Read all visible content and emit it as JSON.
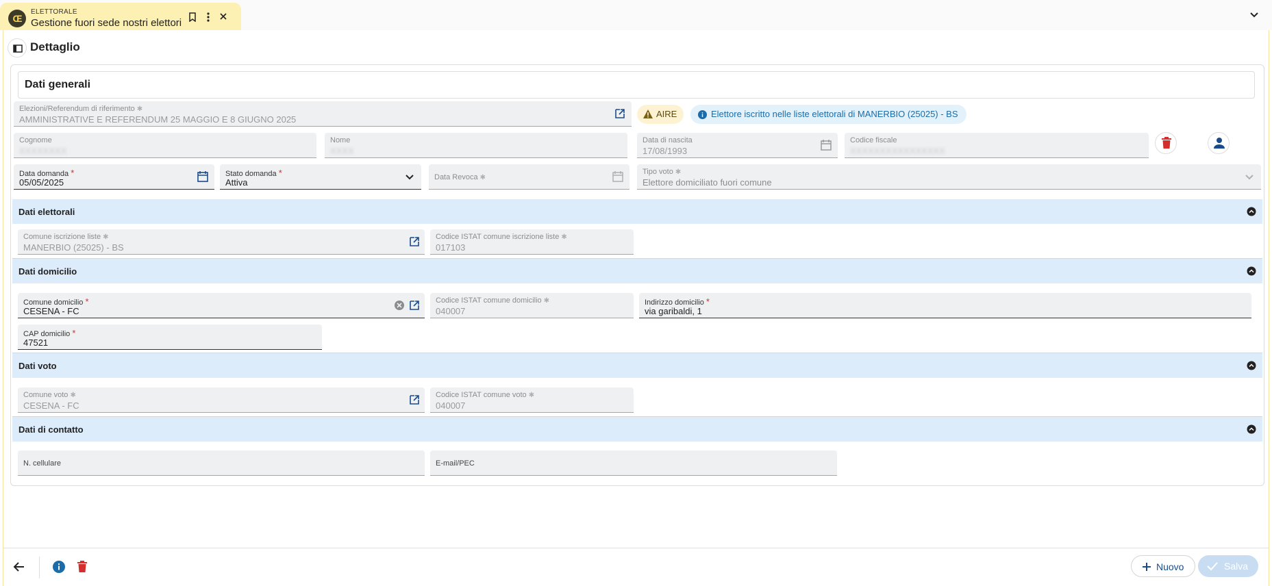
{
  "tab": {
    "module": "ELETTORALE",
    "title": "Gestione fuori sede nostri elettori"
  },
  "page": {
    "title": "Dettaglio"
  },
  "card": {
    "title": "Dati generali"
  },
  "general": {
    "elezioni": {
      "label": "Elezioni/Referendum di riferimento",
      "value": "AMMINISTRATIVE E REFERENDUM 25 MAGGIO E 8 GIUGNO 2025"
    },
    "chip_aire": "AIRE",
    "chip_info": "Elettore iscritto nelle liste elettorali di MANERBIO (25025) - BS",
    "cognome": {
      "label": "Cognome",
      "value": "XXXXXXXX"
    },
    "nome": {
      "label": "Nome",
      "value": "XXXX"
    },
    "data_nascita": {
      "label": "Data di nascita",
      "value": "17/08/1993"
    },
    "codice_fiscale": {
      "label": "Codice fiscale",
      "value": "XXXXXXXXXXXXXXXX"
    },
    "data_domanda": {
      "label": "Data domanda",
      "value": "05/05/2025"
    },
    "stato_domanda": {
      "label": "Stato domanda",
      "value": "Attiva"
    },
    "data_revoca": {
      "label": "Data Revoca",
      "value": ""
    },
    "tipo_voto": {
      "label": "Tipo voto",
      "value": "Elettore domiciliato fuori comune"
    }
  },
  "dati_elettorali": {
    "title": "Dati elettorali",
    "comune_iscrizione": {
      "label": "Comune iscrizione liste",
      "value": "MANERBIO (25025) - BS"
    },
    "istat_iscrizione": {
      "label": "Codice ISTAT comune iscrizione liste",
      "value": "017103"
    }
  },
  "dati_domicilio": {
    "title": "Dati domicilio",
    "comune_domicilio": {
      "label": "Comune domicilio",
      "value": "CESENA - FC"
    },
    "istat_domicilio": {
      "label": "Codice ISTAT comune domicilio",
      "value": "040007"
    },
    "indirizzo": {
      "label": "Indirizzo domicilio",
      "value": "via garibaldi, 1"
    },
    "cap": {
      "label": "CAP domicilio",
      "value": "47521"
    }
  },
  "dati_voto": {
    "title": "Dati voto",
    "comune_voto": {
      "label": "Comune voto",
      "value": "CESENA - FC"
    },
    "istat_voto": {
      "label": "Codice ISTAT comune voto",
      "value": "040007"
    }
  },
  "dati_contatto": {
    "title": "Dati di contatto",
    "cellulare": {
      "label": "N. cellulare"
    },
    "email": {
      "label": "E-mail/PEC"
    }
  },
  "actions": {
    "nuovo": "Nuovo",
    "salva": "Salva"
  },
  "colors": {
    "accent": "#1a4b8c",
    "section_bg": "#dcecfb",
    "danger": "#d32f2f",
    "tab_bg": "#fdf0b3"
  }
}
